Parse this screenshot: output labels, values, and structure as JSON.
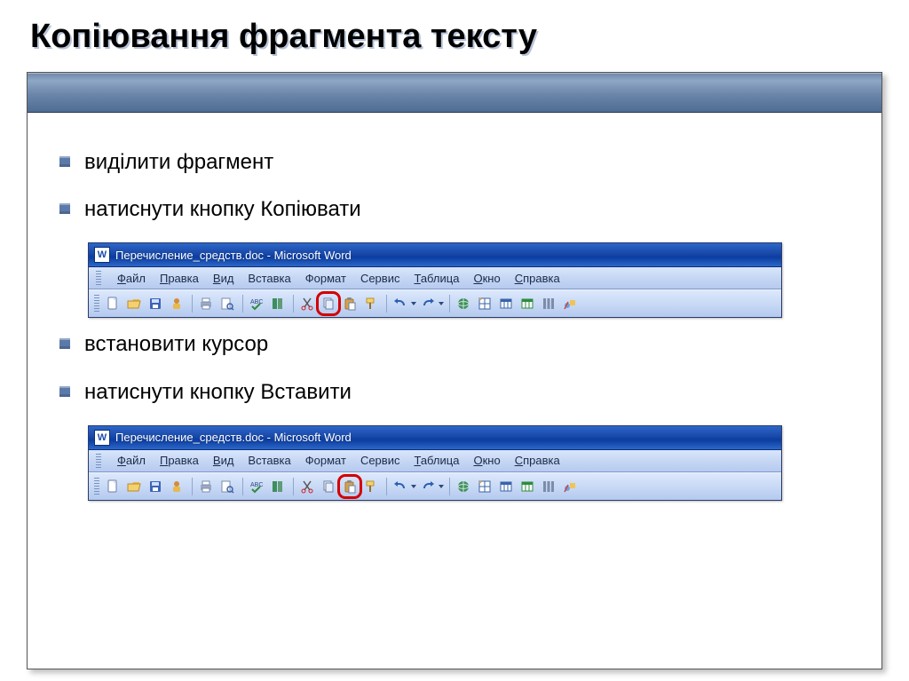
{
  "slide": {
    "title": "Копіювання фрагмента тексту",
    "bullets": [
      "виділити фрагмент",
      "натиснути кнопку Копіювати",
      "встановити курсор",
      "натиснути кнопку Вставити"
    ]
  },
  "word": {
    "appGlyph": "W",
    "title": "Перечисление_средств.doc - Microsoft Word",
    "menus": [
      {
        "label": "Файл",
        "ul": "Ф"
      },
      {
        "label": "Правка",
        "ul": "П"
      },
      {
        "label": "Вид",
        "ul": "В"
      },
      {
        "label": "Вставка",
        "ul": ""
      },
      {
        "label": "Формат",
        "ul": ""
      },
      {
        "label": "Сервис",
        "ul": ""
      },
      {
        "label": "Таблица",
        "ul": "Т"
      },
      {
        "label": "Окно",
        "ul": "О"
      },
      {
        "label": "Справка",
        "ul": "С"
      }
    ]
  },
  "colors": {
    "highlight": "#d40000",
    "titlebarBlue": "#1b4bab",
    "bulletBlue": "#5b7aa9"
  }
}
